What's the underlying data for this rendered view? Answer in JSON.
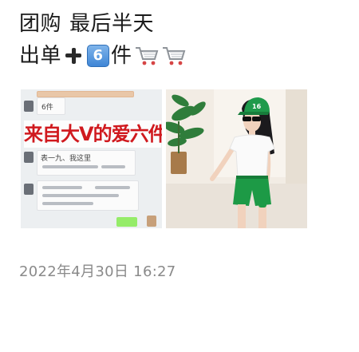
{
  "post": {
    "line1_part1": "团购",
    "line1_part2": "最后半天",
    "line2_prefix": "出单",
    "line2_number": "6",
    "line2_suffix": "件"
  },
  "icons": [
    "plus-icon",
    "keycap-six-icon",
    "shopping-cart-icon",
    "shopping-cart-icon"
  ],
  "photos": {
    "left": {
      "overlay_caption": "来自大V的爱六件",
      "chat_badge": "6件",
      "chat_snippet": "表一九、我这里"
    },
    "right": {
      "cap_badge": "16"
    }
  },
  "timestamp": "2022年4月30日 16:27",
  "colors": {
    "caption_red": "#d0191e",
    "cap_green": "#19a34a",
    "timestamp_gray": "#8a8a8a"
  }
}
